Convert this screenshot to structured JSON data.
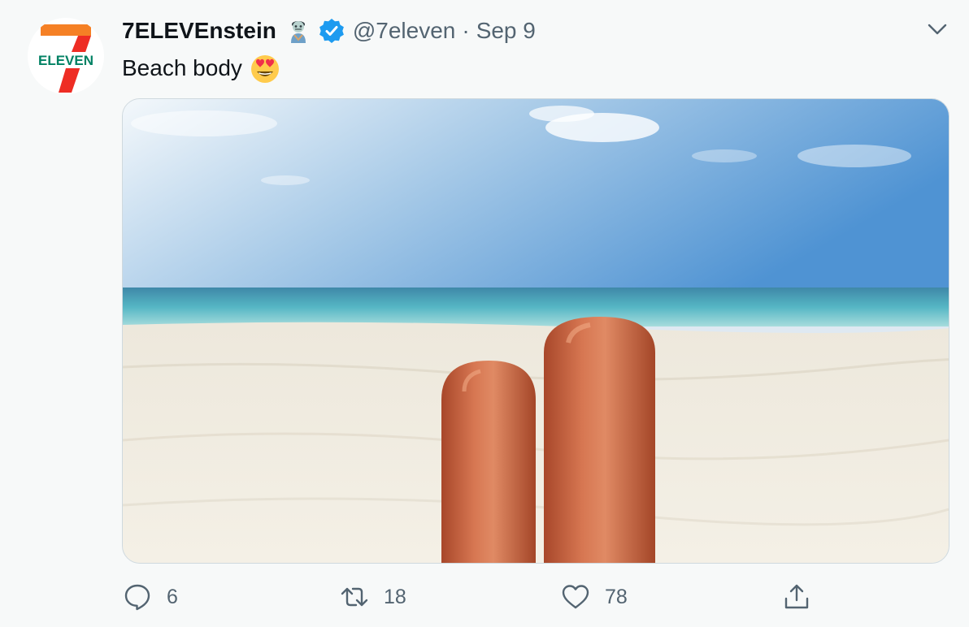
{
  "tweet": {
    "author": {
      "display_name": "7ELEVEnstein",
      "name_emoji": "zombie-emoji",
      "verified": true,
      "handle": "@7eleven",
      "avatar_text": "ELEVEN"
    },
    "separator": "·",
    "date": "Sep 9",
    "text": "Beach body",
    "text_emoji": "heart-eyes-emoji",
    "media": {
      "icon": "beach-photo"
    },
    "actions": {
      "reply_count": "6",
      "retweet_count": "18",
      "like_count": "78"
    }
  },
  "colors": {
    "verified_blue": "#1d9bf0",
    "muted_text": "#536471",
    "seven_orange": "#f58025",
    "seven_red": "#ee2d24",
    "seven_green": "#008163"
  }
}
